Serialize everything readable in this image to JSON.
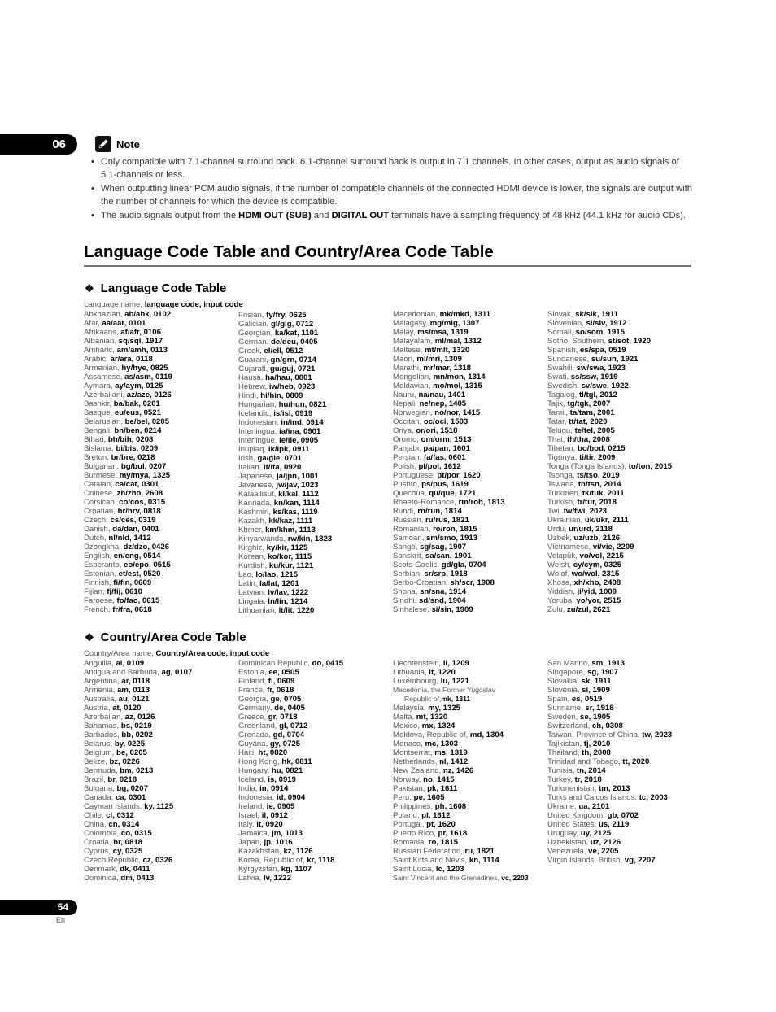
{
  "chapter_tab": "06",
  "note": {
    "label": "Note",
    "items": [
      {
        "pre": "Only compatible with 7.1-channel surround back. 6.1-channel surround back is output in 7.1 channels. In other cases, output as audio signals of 5.1-channels or less.",
        "b1": "",
        "mid": "",
        "b2": "",
        "post": ""
      },
      {
        "pre": "When outputting linear PCM audio signals, if the number of compatible channels of the connected HDMI device is lower, the signals are output with the number of channels for which the device is compatible.",
        "b1": "",
        "mid": "",
        "b2": "",
        "post": ""
      },
      {
        "pre": "The audio signals output from the ",
        "b1": "HDMI OUT (SUB)",
        "mid": " and ",
        "b2": "DIGITAL OUT",
        "post": " terminals have a sampling frequency of 48 kHz (44.1 kHz for audio CDs)."
      }
    ]
  },
  "title": "Language Code Table and Country/Area Code Table",
  "language_section": {
    "title": "Language Code Table",
    "subtitle_plain": "Language name, ",
    "subtitle_bold": "language code, input code",
    "columns": [
      [
        [
          "Abkhazian",
          "ab/abk, 0102"
        ],
        [
          "Afar",
          "aa/aar, 0101"
        ],
        [
          "Afrikaans",
          "af/afr, 0106"
        ],
        [
          "Albanian",
          "sq/sqi, 1917"
        ],
        [
          "Amharic",
          "am/amh, 0113"
        ],
        [
          "Arabic",
          "ar/ara, 0118"
        ],
        [
          "Armenian",
          "hy/hye, 0825"
        ],
        [
          "Assamese",
          "as/asm, 0119"
        ],
        [
          "Aymara",
          "ay/aym, 0125"
        ],
        [
          "Azerbaijani",
          "az/aze, 0126"
        ],
        [
          "Bashkir",
          "ba/bak, 0201"
        ],
        [
          "Basque",
          "eu/eus, 0521"
        ],
        [
          "Belarusian",
          "be/bel, 0205"
        ],
        [
          "Bengali",
          "bn/ben, 0214"
        ],
        [
          "Bihari",
          "bh/bih, 0208"
        ],
        [
          "Bislama",
          "bi/bis, 0209"
        ],
        [
          "Breton",
          "br/bre, 0218"
        ],
        [
          "Bulgarian",
          "bg/bul, 0207"
        ],
        [
          "Burmese",
          "my/mya, 1325"
        ],
        [
          "Catalan",
          "ca/cat, 0301"
        ],
        [
          "Chinese",
          "zh/zho, 2608"
        ],
        [
          "Corsican",
          "co/cos, 0315"
        ],
        [
          "Croatian",
          "hr/hrv, 0818"
        ],
        [
          "Czech",
          "cs/ces, 0319"
        ],
        [
          "Danish",
          "da/dan, 0401"
        ],
        [
          "Dutch",
          "nl/nld, 1412"
        ],
        [
          "Dzongkha",
          "dz/dzo, 0426"
        ],
        [
          "English",
          "en/eng, 0514"
        ],
        [
          "Esperanto",
          "eo/epo, 0515"
        ],
        [
          "Estonian",
          "et/est, 0520"
        ],
        [
          "Finnish",
          "fi/fin, 0609"
        ],
        [
          "Fijian",
          "fj/fij, 0610"
        ],
        [
          "Faroese",
          "fo/fao, 0615"
        ],
        [
          "French",
          "fr/fra, 0618"
        ]
      ],
      [
        [
          "Frisian",
          "fy/fry, 0625"
        ],
        [
          "Galician",
          "gl/glg, 0712"
        ],
        [
          "Georgian",
          "ka/kat, 1101"
        ],
        [
          "German",
          "de/deu, 0405"
        ],
        [
          "Greek",
          "el/ell, 0512"
        ],
        [
          "Guarani",
          "gn/grn, 0714"
        ],
        [
          "Gujarati",
          "gu/guj, 0721"
        ],
        [
          "Hausa",
          "ha/hau, 0801"
        ],
        [
          "Hebrew",
          "iw/heb, 0923"
        ],
        [
          "Hindi",
          "hi/hin, 0809"
        ],
        [
          "Hungarian",
          "hu/hun, 0821"
        ],
        [
          "Icelandic",
          "is/isl, 0919"
        ],
        [
          "Indonesian",
          "in/ind, 0914"
        ],
        [
          "Interlingua",
          "ia/ina, 0901"
        ],
        [
          "Interlingue",
          "ie/ile, 0905"
        ],
        [
          "Inupiaq",
          "ik/ipk, 0911"
        ],
        [
          "Irish",
          "ga/gle, 0701"
        ],
        [
          "Italian",
          "it/ita, 0920"
        ],
        [
          "Japanese",
          "ja/jpn, 1001"
        ],
        [
          "Javanese",
          "jw/jav, 1023"
        ],
        [
          "Kalaallisut",
          "kl/kal, 1112"
        ],
        [
          "Kannada",
          "kn/kan, 1114"
        ],
        [
          "Kashmiri",
          "ks/kas, 1119"
        ],
        [
          "Kazakh",
          "kk/kaz, 1111"
        ],
        [
          "Khmer",
          "km/khm, 1113"
        ],
        [
          "Kinyarwanda",
          "rw/kin, 1823"
        ],
        [
          "Kirghiz",
          "ky/kir, 1125"
        ],
        [
          "Korean",
          "ko/kor, 1115"
        ],
        [
          "Kurdish",
          "ku/kur, 1121"
        ],
        [
          "Lao",
          "lo/lao, 1215"
        ],
        [
          "Latin",
          "la/lat, 1201"
        ],
        [
          "Latvian",
          "lv/lav, 1222"
        ],
        [
          "Lingala",
          "ln/lin, 1214"
        ],
        [
          "Lithuanian",
          "lt/lit, 1220"
        ]
      ],
      [
        [
          "Macedonian",
          "mk/mkd, 1311"
        ],
        [
          "Malagasy",
          "mg/mlg, 1307"
        ],
        [
          "Malay",
          "ms/msa, 1319"
        ],
        [
          "Malayalam",
          "ml/mal, 1312"
        ],
        [
          "Maltese",
          "mt/mlt, 1320"
        ],
        [
          "Maori",
          "mi/mri, 1309"
        ],
        [
          "Marathi",
          "mr/mar, 1318"
        ],
        [
          "Mongolian",
          "mn/mon, 1314"
        ],
        [
          "Moldavian",
          "mo/mol, 1315"
        ],
        [
          "Nauru",
          "na/nau, 1401"
        ],
        [
          "Nepali",
          "ne/nep, 1405"
        ],
        [
          "Norwegian",
          "no/nor, 1415"
        ],
        [
          "Occitan",
          "oc/oci, 1503"
        ],
        [
          "Oriya",
          "or/ori, 1518"
        ],
        [
          "Oromo",
          "om/orm, 1513"
        ],
        [
          "Panjabi",
          "pa/pan, 1601"
        ],
        [
          "Persian",
          "fa/fas, 0601"
        ],
        [
          "Polish",
          "pl/pol, 1612"
        ],
        [
          "Portuguese",
          "pt/por, 1620"
        ],
        [
          "Pushto",
          "ps/pus, 1619"
        ],
        [
          "Quechua",
          "qu/que, 1721"
        ],
        [
          "Rhaeto-Romance",
          "rm/roh, 1813"
        ],
        [
          "Rundi",
          "rn/run, 1814"
        ],
        [
          "Russian",
          "ru/rus, 1821"
        ],
        [
          "Romanian",
          "ro/ron, 1815"
        ],
        [
          "Samoan",
          "sm/smo, 1913"
        ],
        [
          "Sango",
          "sg/sag, 1907"
        ],
        [
          "Sanskrit",
          "sa/san, 1901"
        ],
        [
          "Scots-Gaelic",
          "gd/gla, 0704"
        ],
        [
          "Serbian",
          "sr/srp, 1918"
        ],
        [
          "Serbo-Croatian",
          "sh/scr, 1908"
        ],
        [
          "Shona",
          "sn/sna, 1914"
        ],
        [
          "Sindhi",
          "sd/snd, 1904"
        ],
        [
          "Sinhalese",
          "si/sin, 1909"
        ]
      ],
      [
        [
          "Slovak",
          "sk/slk, 1911"
        ],
        [
          "Slovenian",
          "sl/slv, 1912"
        ],
        [
          "Somali",
          "so/som, 1915"
        ],
        [
          "Sotho, Southern",
          "st/sot, 1920"
        ],
        [
          "Spanish",
          "es/spa, 0519"
        ],
        [
          "Sundanese",
          "su/sun, 1921"
        ],
        [
          "Swahili",
          "sw/swa, 1923"
        ],
        [
          "Swati",
          "ss/ssw, 1919"
        ],
        [
          "Swedish",
          "sv/swe, 1922"
        ],
        [
          "Tagalog",
          "tl/tgl, 2012"
        ],
        [
          "Tajik",
          "tg/tgk, 2007"
        ],
        [
          "Tamil",
          "ta/tam, 2001"
        ],
        [
          "Tatar",
          "tt/tat, 2020"
        ],
        [
          "Telugu",
          "te/tel, 2005"
        ],
        [
          "Thai",
          "th/tha, 2008"
        ],
        [
          "Tibetan",
          "bo/bod, 0215"
        ],
        [
          "Tigrinya",
          "ti/tir, 2009"
        ],
        [
          "Tonga (Tonga Islands)",
          "to/ton, 2015"
        ],
        [
          "Tsonga",
          "ts/tso, 2019"
        ],
        [
          "Tswana",
          "tn/tsn, 2014"
        ],
        [
          "Turkmen",
          "tk/tuk, 2011"
        ],
        [
          "Turkish",
          "tr/tur, 2018"
        ],
        [
          "Twi",
          "tw/twi, 2023"
        ],
        [
          "Ukrainian",
          "uk/ukr, 2111"
        ],
        [
          "Urdu",
          "ur/urd, 2118"
        ],
        [
          "Uzbek",
          "uz/uzb, 2126"
        ],
        [
          "Vietnamese",
          "vi/vie, 2209"
        ],
        [
          "Volapük",
          "vo/vol, 2215"
        ],
        [
          "Welsh",
          "cy/cym, 0325"
        ],
        [
          "Wolof",
          "wo/wol, 2315"
        ],
        [
          "Xhosa",
          "xh/xho, 2408"
        ],
        [
          "Yiddish",
          "ji/yid, 1009"
        ],
        [
          "Yoruba",
          "yo/yor, 2515"
        ],
        [
          "Zulu",
          "zu/zul, 2621"
        ]
      ]
    ]
  },
  "country_section": {
    "title": "Country/Area Code Table",
    "subtitle_plain": "Country/Area name, ",
    "subtitle_bold": "Country/Area code, input code",
    "columns": [
      [
        [
          "Anguilla",
          "ai, 0109"
        ],
        [
          "Antigua and Barbuda",
          "ag, 0107"
        ],
        [
          "Argentina",
          "ar, 0118"
        ],
        [
          "Armenia",
          "am, 0113"
        ],
        [
          "Australia",
          "au, 0121"
        ],
        [
          "Austria",
          "at, 0120"
        ],
        [
          "Azerbaijan",
          "az, 0126"
        ],
        [
          "Bahamas",
          "bs, 0219"
        ],
        [
          "Barbados",
          "bb, 0202"
        ],
        [
          "Belarus",
          "by, 0225"
        ],
        [
          "Belgium",
          "be, 0205"
        ],
        [
          "Belize",
          "bz, 0226"
        ],
        [
          "Bermuda",
          "bm, 0213"
        ],
        [
          "Brazil",
          "br, 0218"
        ],
        [
          "Bulgaria",
          "bg, 0207"
        ],
        [
          "Canada",
          "ca, 0301"
        ],
        [
          "Cayman Islands",
          "ky, 1125"
        ],
        [
          "Chile",
          "cl, 0312"
        ],
        [
          "China",
          "cn, 0314"
        ],
        [
          "Colombia",
          "co, 0315"
        ],
        [
          "Croatia",
          "hr, 0818"
        ],
        [
          "Cyprus",
          "cy, 0325"
        ],
        [
          "Czech Republic",
          "cz, 0326"
        ],
        [
          "Denmark",
          "dk, 0411"
        ],
        [
          "Dominica",
          "dm, 0413"
        ]
      ],
      [
        [
          "Dominican Republic",
          "do, 0415"
        ],
        [
          "Estonia",
          "ee, 0505"
        ],
        [
          "Finland",
          "fi, 0609"
        ],
        [
          "France",
          "fr, 0618"
        ],
        [
          "Georgia",
          "ge, 0705"
        ],
        [
          "Germany",
          "de, 0405"
        ],
        [
          "Greece",
          "gr, 0718"
        ],
        [
          "Greenland",
          "gl, 0712"
        ],
        [
          "Grenada",
          "gd, 0704"
        ],
        [
          "Guyana",
          "gy, 0725"
        ],
        [
          "Haiti",
          "ht, 0820"
        ],
        [
          "Hong Kong",
          "hk, 0811"
        ],
        [
          "Hungary",
          "hu, 0821"
        ],
        [
          "Iceland",
          "is, 0919"
        ],
        [
          "India",
          "in, 0914"
        ],
        [
          "Indonesia",
          "id, 0904"
        ],
        [
          "Ireland",
          "ie, 0905"
        ],
        [
          "Israel",
          "il, 0912"
        ],
        [
          "Italy",
          "it, 0920"
        ],
        [
          "Jamaica",
          "jm, 1013"
        ],
        [
          "Japan",
          "jp, 1016"
        ],
        [
          "Kazakhstan",
          "kz, 1126"
        ],
        [
          "Korea, Republic of",
          "kr, 1118"
        ],
        [
          "Kyrgyzstan",
          "kg, 1107"
        ],
        [
          "Latvia",
          "lv, 1222"
        ]
      ],
      [
        [
          "Liechtenstein",
          "li, 1209"
        ],
        [
          "Lithuania",
          "lt, 1220"
        ],
        [
          "Luxembourg",
          "lu, 1221"
        ],
        [
          "Macedonia, the Former Yugoslav|Republic of",
          "mk, 1311"
        ],
        [
          "Malaysia",
          "my, 1325"
        ],
        [
          "Malta",
          "mt, 1320"
        ],
        [
          "Mexico",
          "mx, 1324"
        ],
        [
          "Moldova, Republic of",
          "md, 1304"
        ],
        [
          "Monaco",
          "mc, 1303"
        ],
        [
          "Montserrat",
          "ms, 1319"
        ],
        [
          "Netherlands",
          "nl, 1412"
        ],
        [
          "New Zealand",
          "nz, 1426"
        ],
        [
          "Norway",
          "no, 1415"
        ],
        [
          "Pakistan",
          "pk, 1611"
        ],
        [
          "Peru",
          "pe, 1605"
        ],
        [
          "Philippines",
          "ph, 1608"
        ],
        [
          "Poland",
          "pl, 1612"
        ],
        [
          "Portugal",
          "pt, 1620"
        ],
        [
          "Puerto Rico",
          "pr, 1618"
        ],
        [
          "Romania",
          "ro, 1815"
        ],
        [
          "Russian Federation",
          "ru, 1821"
        ],
        [
          "Saint Kitts and Nevis",
          "kn, 1114"
        ],
        [
          "Saint Lucia",
          "lc, 1203"
        ],
        [
          "Saint Vincent and the Grenadines",
          "vc, 2203"
        ]
      ],
      [
        [
          "San Marino",
          "sm, 1913"
        ],
        [
          "Singapore",
          "sg, 1907"
        ],
        [
          "Slovakia",
          "sk, 1911"
        ],
        [
          "Slovenia",
          "si, 1909"
        ],
        [
          "Spain",
          "es, 0519"
        ],
        [
          "Suriname",
          "sr, 1918"
        ],
        [
          "Sweden",
          "se, 1905"
        ],
        [
          "Switzerland",
          "ch, 0308"
        ],
        [
          "Taiwan, Province of China",
          "tw, 2023"
        ],
        [
          "Tajikistan",
          "tj, 2010"
        ],
        [
          "Thailand",
          "th, 2008"
        ],
        [
          "Trinidad and Tobago",
          "tt, 2020"
        ],
        [
          "Tunisia",
          "tn, 2014"
        ],
        [
          "Turkey",
          "tr, 2018"
        ],
        [
          "Turkmenistan",
          "tm, 2013"
        ],
        [
          "Turks and Caicos Islands",
          "tc, 2003"
        ],
        [
          "Ukraine",
          "ua, 2101"
        ],
        [
          "United Kingdom",
          "gb, 0702"
        ],
        [
          "United States",
          "us, 2119"
        ],
        [
          "Uruguay",
          "uy, 2125"
        ],
        [
          "Uzbekistan",
          "uz, 2126"
        ],
        [
          "Venezuela",
          "ve, 2205"
        ],
        [
          "Virgin Islands, British",
          "vg, 2207"
        ]
      ]
    ]
  },
  "footer": {
    "page_number": "54",
    "language": "En"
  }
}
